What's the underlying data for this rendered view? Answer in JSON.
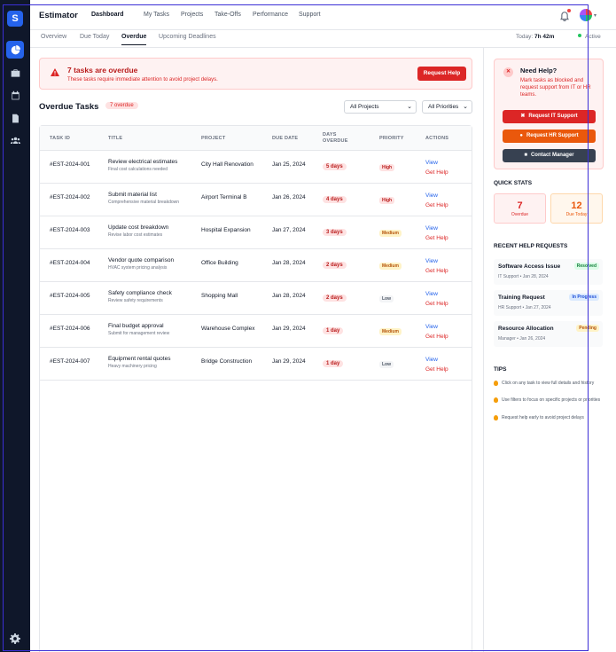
{
  "app": {
    "brand": "Estimator",
    "logo_letter": "S"
  },
  "topnav": [
    {
      "label": "Dashboard",
      "active": true
    },
    {
      "label": "My Tasks"
    },
    {
      "label": "Projects"
    },
    {
      "label": "Take-Offs"
    },
    {
      "label": "Performance"
    },
    {
      "label": "Support"
    }
  ],
  "subnav": {
    "tabs": [
      {
        "label": "Overview"
      },
      {
        "label": "Due Today"
      },
      {
        "label": "Overdue",
        "active": true
      },
      {
        "label": "Upcoming Deadlines"
      }
    ],
    "today_label": "Today:",
    "today_value": "7h 42m",
    "status": "Active"
  },
  "alert": {
    "title": "7 tasks are overdue",
    "subtitle": "These tasks require immediate attention to avoid project delays.",
    "button": "Request Help"
  },
  "section": {
    "title": "Overdue Tasks",
    "badge": "7 overdue",
    "filter_project": "All Projects",
    "filter_priority": "All Priorities"
  },
  "table": {
    "headers": {
      "task_id": "TASK ID",
      "title": "TITLE",
      "project": "PROJECT",
      "due_date": "DUE DATE",
      "days_overdue": "DAYS OVERDUE",
      "priority": "PRIORITY",
      "actions": "ACTIONS"
    },
    "view_label": "View",
    "help_label": "Get Help",
    "rows": [
      {
        "id": "#EST-2024-001",
        "title": "Review electrical estimates",
        "subtitle": "Final cost calculations needed",
        "project": "City Hall Renovation",
        "due": "Jan 25, 2024",
        "days": "5 days",
        "priority": "High"
      },
      {
        "id": "#EST-2024-002",
        "title": "Submit material list",
        "subtitle": "Comprehensive material breakdown",
        "project": "Airport Terminal B",
        "due": "Jan 26, 2024",
        "days": "4 days",
        "priority": "High"
      },
      {
        "id": "#EST-2024-003",
        "title": "Update cost breakdown",
        "subtitle": "Revise labor cost estimates",
        "project": "Hospital Expansion",
        "due": "Jan 27, 2024",
        "days": "3 days",
        "priority": "Medium"
      },
      {
        "id": "#EST-2024-004",
        "title": "Vendor quote comparison",
        "subtitle": "HVAC system pricing analysis",
        "project": "Office Building",
        "due": "Jan 28, 2024",
        "days": "2 days",
        "priority": "Medium"
      },
      {
        "id": "#EST-2024-005",
        "title": "Safety compliance check",
        "subtitle": "Review safety requirements",
        "project": "Shopping Mall",
        "due": "Jan 28, 2024",
        "days": "2 days",
        "priority": "Low"
      },
      {
        "id": "#EST-2024-006",
        "title": "Final budget approval",
        "subtitle": "Submit for management review",
        "project": "Warehouse Complex",
        "due": "Jan 29, 2024",
        "days": "1 day",
        "priority": "Medium"
      },
      {
        "id": "#EST-2024-007",
        "title": "Equipment rental quotes",
        "subtitle": "Heavy machinery pricing",
        "project": "Bridge Construction",
        "due": "Jan 29, 2024",
        "days": "1 day",
        "priority": "Low"
      }
    ]
  },
  "help_panel": {
    "title": "Need Help?",
    "desc": "Mark tasks as blocked and request support from IT or HR teams.",
    "btn_it": "Request IT Support",
    "btn_hr": "Request HR Support",
    "btn_manager": "Contact Manager",
    "colors": {
      "it": "#dc2626",
      "hr": "#ea580c",
      "manager": "#374151"
    }
  },
  "quick_stats": {
    "heading": "QUICK STATS",
    "overdue_value": "7",
    "overdue_label": "Overdue",
    "due_today_value": "12",
    "due_today_label": "Due Today"
  },
  "recent": {
    "heading": "RECENT HELP REQUESTS",
    "items": [
      {
        "title": "Software Access Issue",
        "meta": "IT Support • Jan 28, 2024",
        "status": "Resolved"
      },
      {
        "title": "Training Request",
        "meta": "HR Support • Jan 27, 2024",
        "status": "In Progress"
      },
      {
        "title": "Resource Allocation",
        "meta": "Manager • Jan 26, 2024",
        "status": "Pending"
      }
    ]
  },
  "tips": {
    "heading": "TIPS",
    "items": [
      "Click on any task to view full details and history",
      "Use filters to focus on specific projects or priorities",
      "Request help early to avoid project delays"
    ]
  }
}
